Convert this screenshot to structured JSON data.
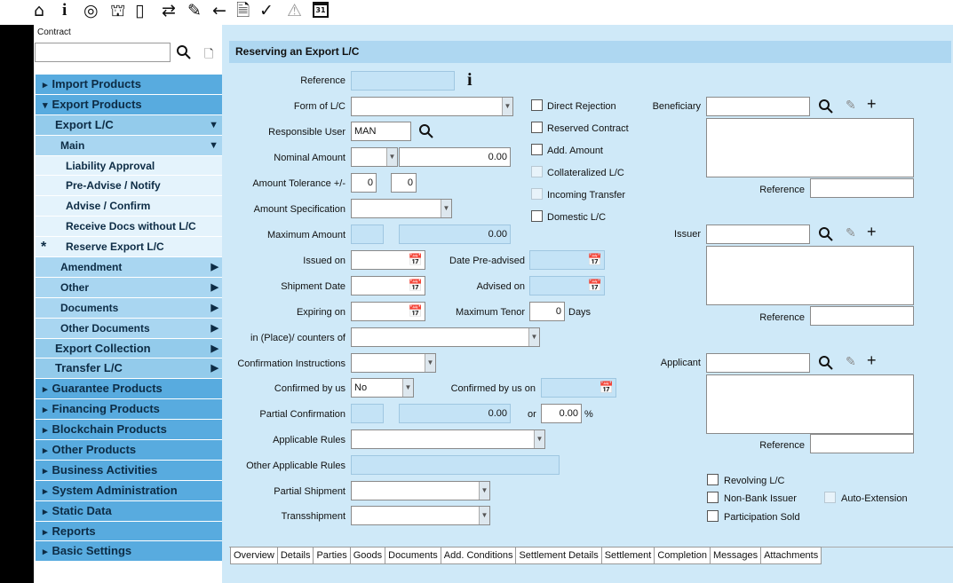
{
  "toolbar": {
    "icons": [
      "home-icon",
      "info-icon",
      "target-icon",
      "handshake-icon",
      "book-icon",
      "exchange-icon",
      "edit-icon",
      "arrow-left-icon",
      "document-check-icon",
      "check-icon",
      "warning-icon",
      "calendar-icon"
    ],
    "calendar_day": "31"
  },
  "contract": {
    "label": "Contract",
    "value": ""
  },
  "sidebar": {
    "items": [
      {
        "label": "Import Products",
        "level": 0,
        "arrow": "▸"
      },
      {
        "label": "Export Products",
        "level": 0,
        "arrow": "▾"
      },
      {
        "label": "Export L/C",
        "level": 1,
        "arrow": "▼"
      },
      {
        "label": "Main",
        "level": 2,
        "arrow": "▼"
      },
      {
        "label": "Liability Approval",
        "level": 3
      },
      {
        "label": "Pre-Advise / Notify",
        "level": 3
      },
      {
        "label": "Advise / Confirm",
        "level": 3
      },
      {
        "label": "Receive Docs without L/C",
        "level": 3
      },
      {
        "label": "Reserve Export L/C",
        "level": 3,
        "current": true
      },
      {
        "label": "Amendment",
        "level": 2,
        "arrow": "▶"
      },
      {
        "label": "Other",
        "level": 2,
        "arrow": "▶"
      },
      {
        "label": "Documents",
        "level": 2,
        "arrow": "▶"
      },
      {
        "label": "Other Documents",
        "level": 2,
        "arrow": "▶"
      },
      {
        "label": "Export Collection",
        "level": 1,
        "arrow": "▶"
      },
      {
        "label": "Transfer L/C",
        "level": 1,
        "arrow": "▶"
      },
      {
        "label": "Guarantee Products",
        "level": 0,
        "arrow": "▸"
      },
      {
        "label": "Financing Products",
        "level": 0,
        "arrow": "▸"
      },
      {
        "label": "Blockchain Products",
        "level": 0,
        "arrow": "▸"
      },
      {
        "label": "Other Products",
        "level": 0,
        "arrow": "▸"
      },
      {
        "label": "Business Activities",
        "level": 0,
        "arrow": "▸"
      },
      {
        "label": "System Administration",
        "level": 0,
        "arrow": "▸"
      },
      {
        "label": "Static Data",
        "level": 0,
        "arrow": "▸"
      },
      {
        "label": "Reports",
        "level": 0,
        "arrow": "▸"
      },
      {
        "label": "Basic Settings",
        "level": 0,
        "arrow": "▸"
      }
    ]
  },
  "page": {
    "title": "Reserving an Export L/C"
  },
  "form": {
    "reference": {
      "label": "Reference",
      "value": ""
    },
    "form_of_lc": {
      "label": "Form of L/C",
      "value": ""
    },
    "responsible_user": {
      "label": "Responsible User",
      "value": "MAN"
    },
    "nominal_amount": {
      "label": "Nominal Amount",
      "currency": "",
      "value": "0.00"
    },
    "amount_tolerance": {
      "label": "Amount Tolerance +/-",
      "plus": "0",
      "minus": "0"
    },
    "amount_specification": {
      "label": "Amount Specification",
      "value": ""
    },
    "maximum_amount": {
      "label": "Maximum Amount",
      "currency": "",
      "value": "0.00"
    },
    "issued_on": {
      "label": "Issued on",
      "value": ""
    },
    "shipment_date": {
      "label": "Shipment Date",
      "value": ""
    },
    "expiring_on": {
      "label": "Expiring on",
      "value": ""
    },
    "date_pre_advised": {
      "label": "Date Pre-advised",
      "value": ""
    },
    "advised_on": {
      "label": "Advised on",
      "value": ""
    },
    "maximum_tenor": {
      "label": "Maximum Tenor",
      "value": "0",
      "unit": "Days"
    },
    "place_counters": {
      "label": "in (Place)/ counters of",
      "value": ""
    },
    "confirmation_instructions": {
      "label": "Confirmation Instructions",
      "value": ""
    },
    "confirmed_by_us": {
      "label": "Confirmed by us",
      "value": "No"
    },
    "confirmed_by_us_on": {
      "label": "Confirmed by us on",
      "value": ""
    },
    "partial_confirmation": {
      "label": "Partial Confirmation",
      "currency": "",
      "value": "0.00",
      "or_label": "or",
      "percent": "0.00",
      "percent_sign": "%"
    },
    "applicable_rules": {
      "label": "Applicable Rules",
      "value": ""
    },
    "other_applicable_rules": {
      "label": "Other Applicable Rules",
      "value": ""
    },
    "partial_shipment": {
      "label": "Partial Shipment",
      "value": ""
    },
    "transshipment": {
      "label": "Transshipment",
      "value": ""
    },
    "checkboxes": {
      "direct_rejection": "Direct Rejection",
      "reserved_contract": "Reserved Contract",
      "add_amount": "Add. Amount",
      "collateralized_lc": "Collateralized L/C",
      "incoming_transfer": "Incoming Transfer",
      "domestic_lc": "Domestic L/C",
      "revolving_lc": "Revolving L/C",
      "non_bank_issuer": "Non-Bank Issuer",
      "auto_extension": "Auto-Extension",
      "participation_sold": "Participation Sold"
    },
    "parties": {
      "beneficiary": {
        "label": "Beneficiary",
        "value": "",
        "reference_label": "Reference"
      },
      "issuer": {
        "label": "Issuer",
        "value": "",
        "reference_label": "Reference"
      },
      "applicant": {
        "label": "Applicant",
        "value": "",
        "reference_label": "Reference"
      }
    }
  },
  "tabs": [
    "Overview",
    "Details",
    "Parties",
    "Goods",
    "Documents",
    "Add. Conditions",
    "Settlement Details",
    "Settlement",
    "Completion",
    "Messages",
    "Attachments"
  ]
}
